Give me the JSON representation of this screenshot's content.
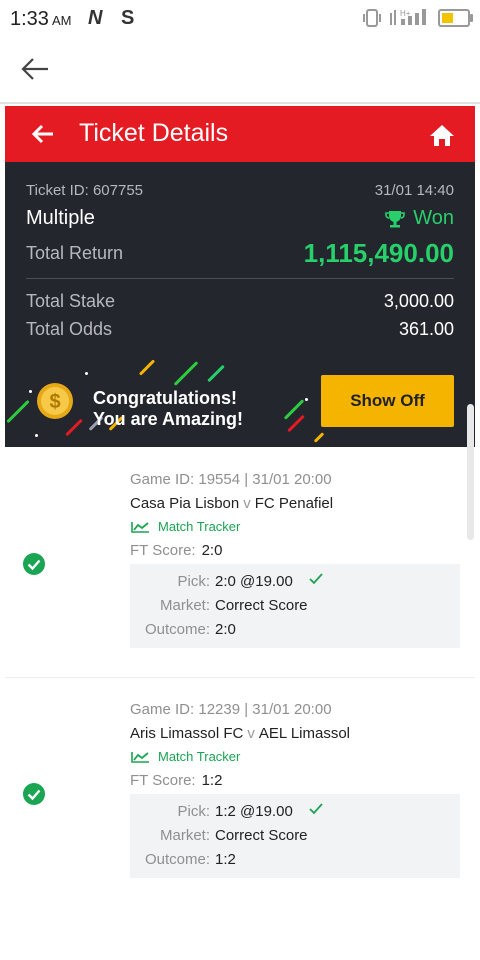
{
  "status_bar": {
    "time": "1:33",
    "ampm": "AM",
    "notif_1": "N",
    "notif_2": "S",
    "network_type": "H+"
  },
  "header": {
    "title": "Ticket Details"
  },
  "ticket": {
    "id_text": "Ticket ID: 607755",
    "datetime": "31/01 14:40",
    "type": "Multiple",
    "status": "Won",
    "total_return_label": "Total Return",
    "total_return_value": "1,115,490.00",
    "total_stake_label": "Total Stake",
    "total_stake_value": "3,000.00",
    "total_odds_label": "Total Odds",
    "total_odds_value": "361.00"
  },
  "promo": {
    "line1": "Congratulations!",
    "line2": "You are Amazing!",
    "button_label": "Show Off"
  },
  "games": [
    {
      "game_id_text": "Game ID: 19554 | 31/01 20:00",
      "home": "Casa Pia Lisbon",
      "vs": "v",
      "away": "FC Penafiel",
      "tracker_label": "Match Tracker",
      "ft_label": "FT Score:",
      "ft_value": "2:0",
      "pick_label": "Pick:",
      "pick_value": "2:0 @19.00",
      "market_label": "Market:",
      "market_value": "Correct Score",
      "outcome_label": "Outcome:",
      "outcome_value": "2:0"
    },
    {
      "game_id_text": "Game ID: 12239 | 31/01 20:00",
      "home": "Aris Limassol FC",
      "vs": "v",
      "away": "AEL Limassol",
      "tracker_label": "Match Tracker",
      "ft_label": "FT Score:",
      "ft_value": "1:2",
      "pick_label": "Pick:",
      "pick_value": "1:2 @19.00",
      "market_label": "Market:",
      "market_value": "Correct Score",
      "outcome_label": "Outcome:",
      "outcome_value": "1:2"
    }
  ],
  "colors": {
    "brand_red": "#e41b23",
    "won_green": "#27d06a",
    "accent_yellow": "#f5b400",
    "panel_dark": "#23262d"
  },
  "icons": [
    "back-arrow-icon",
    "home-icon",
    "trophy-icon",
    "coin-icon",
    "check-circle-icon",
    "chart-line-icon",
    "checkmark-icon"
  ]
}
